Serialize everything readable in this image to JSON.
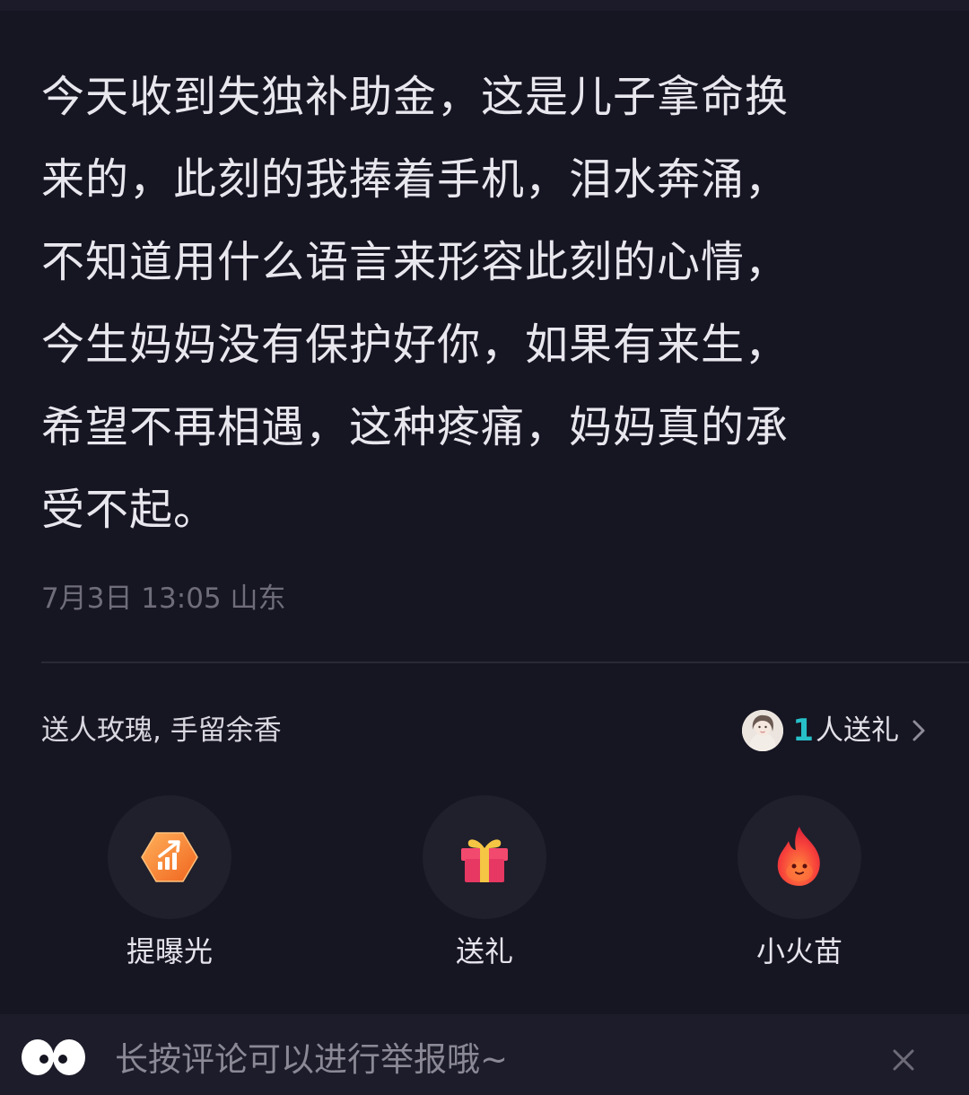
{
  "post": {
    "text": "今天收到失独补助金，这是儿子拿命换来的，此刻的我捧着手机，泪水奔涌，不知道用什么语言来形容此刻的心情，今生妈妈没有保护好你，如果有来生，希望不再相遇，这种疼痛，妈妈真的承受不起。",
    "lines": [
      "今天收到失独补助金，这是儿子拿命换",
      "来的，此刻的我捧着手机，泪水奔涌，",
      "不知道用什么语言来形容此刻的心情，",
      "今生妈妈没有保护好你，如果有来生，",
      "希望不再相遇，这种疼痛，妈妈真的承",
      "受不起。"
    ],
    "meta": "7月3日 13:05 山东"
  },
  "gift": {
    "slogan": "送人玫瑰, 手留余香",
    "count": "1",
    "count_label": "人送礼",
    "avatar_icon": "user-avatar",
    "chevron_icon": "chevron-right-icon"
  },
  "actions": [
    {
      "label": "提曝光",
      "icon": "boost-exposure-icon"
    },
    {
      "label": "送礼",
      "icon": "gift-box-icon"
    },
    {
      "label": "小火苗",
      "icon": "flame-icon"
    }
  ],
  "report_bar": {
    "text": "长按评论可以进行举报哦~",
    "icon": "eyes-icon",
    "close_icon": "close-icon"
  },
  "colors": {
    "background": "#161522",
    "accent_count": "#27c0c8",
    "boost_orange": "#f7852b",
    "gift_pink": "#f2496e",
    "flame_red": "#f7413b"
  }
}
